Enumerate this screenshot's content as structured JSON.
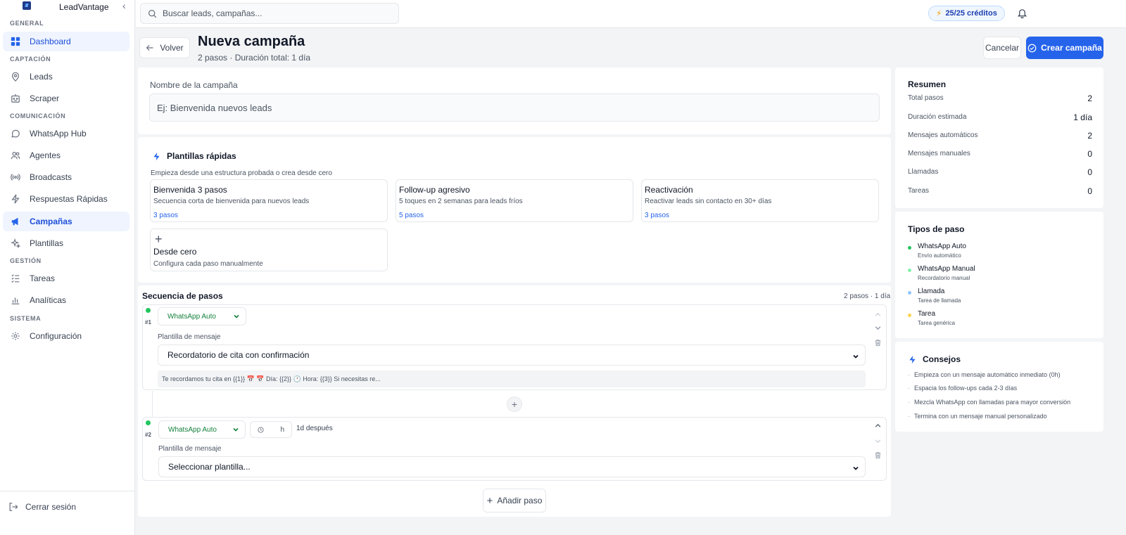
{
  "app": {
    "brand": "LeadVantage"
  },
  "sidebar": {
    "sections": [
      "GENERAL",
      "CAPTACIÓN",
      "COMUNICACIÓN",
      "GESTIÓN",
      "SISTEMA"
    ],
    "items": [
      {
        "label": "Dashboard",
        "icon": "grid-icon"
      },
      {
        "label": "Leads",
        "icon": "map-pin-icon"
      },
      {
        "label": "Scraper",
        "icon": "bot-icon"
      },
      {
        "label": "WhatsApp Hub",
        "icon": "message-circle-icon"
      },
      {
        "label": "Agentes",
        "icon": "users-icon"
      },
      {
        "label": "Broadcasts",
        "icon": "radio-icon"
      },
      {
        "label": "Respuestas Rápidas",
        "icon": "zap-icon"
      },
      {
        "label": "Campañas",
        "icon": "megaphone-icon"
      },
      {
        "label": "Plantillas",
        "icon": "sparkles-icon"
      },
      {
        "label": "Tareas",
        "icon": "list-checks-icon"
      },
      {
        "label": "Analíticas",
        "icon": "bar-chart-icon"
      },
      {
        "label": "Configuración",
        "icon": "gear-icon"
      }
    ],
    "active": "Campañas",
    "logout": "Cerrar sesión"
  },
  "topbar": {
    "search_placeholder": "Buscar leads, campañas...",
    "credits": "25/25 créditos"
  },
  "header": {
    "back": "Volver",
    "title": "Nueva campaña",
    "subtitle": "2 pasos · Duración total: 1 día",
    "cancel": "Cancelar",
    "create": "Crear campaña"
  },
  "name_card": {
    "label": "Nombre de la campaña",
    "placeholder": "Ej: Bienvenida nuevos leads"
  },
  "templates": {
    "title": "Plantillas rápidas",
    "description": "Empieza desde una estructura probada o crea desde cero",
    "items": [
      {
        "name": "Bienvenida 3 pasos",
        "desc": "Secuencia corta de bienvenida para nuevos leads",
        "steps": "3 pasos"
      },
      {
        "name": "Follow-up agresivo",
        "desc": "5 toques en 2 semanas para leads fríos",
        "steps": "5 pasos"
      },
      {
        "name": "Reactivación",
        "desc": "Reactivar leads sin contacto en 30+ días",
        "steps": "3 pasos"
      }
    ],
    "scratch": {
      "name": "Desde cero",
      "desc": "Configura cada paso manualmente"
    }
  },
  "sequence": {
    "title": "Secuencia de pasos",
    "meta": "2 pasos · 1 día",
    "steps": [
      {
        "num": "#1",
        "type": "WhatsApp Auto",
        "template_label": "Plantilla de mensaje",
        "template_value": "Recordatorio de cita con confirmación",
        "preview": "Te recordamos tu cita en {{1}} 📅 📅 Día: {{2}} 🕐 Hora: {{3}} Si necesitas re..."
      },
      {
        "num": "#2",
        "type": "WhatsApp Auto",
        "delay_unit": "h",
        "delay_text": "1d después",
        "template_label": "Plantilla de mensaje",
        "template_value": "Seleccionar plantilla..."
      }
    ],
    "add_step": "Añadir paso"
  },
  "summary": {
    "title": "Resumen",
    "rows": [
      {
        "label": "Total pasos",
        "value": "2"
      },
      {
        "label": "Duración estimada",
        "value": "1 día"
      },
      {
        "label": "Mensajes automáticos",
        "value": "2"
      },
      {
        "label": "Mensajes manuales",
        "value": "0"
      },
      {
        "label": "Llamadas",
        "value": "0"
      },
      {
        "label": "Tareas",
        "value": "0"
      }
    ]
  },
  "step_types": {
    "title": "Tipos de paso",
    "items": [
      {
        "name": "WhatsApp Auto",
        "desc": "Envío automático",
        "color": "#22c55e"
      },
      {
        "name": "WhatsApp Manual",
        "desc": "Recordatorio manual",
        "color": "#86efac"
      },
      {
        "name": "Llamada",
        "desc": "Tarea de llamada",
        "color": "#93c5fd"
      },
      {
        "name": "Tarea",
        "desc": "Tarea genérica",
        "color": "#fcd34d"
      }
    ]
  },
  "tips": {
    "title": "Consejos",
    "items": [
      "Empieza con un mensaje automático inmediato (0h)",
      "Espacia los follow-ups cada 2-3 días",
      "Mezcla WhatsApp con llamadas para mayor conversión",
      "Termina con un mensaje manual personalizado"
    ]
  },
  "colors": {
    "accent": "#2563eb",
    "whatsapp": "#22c55e",
    "background": "#f3f4f6"
  }
}
